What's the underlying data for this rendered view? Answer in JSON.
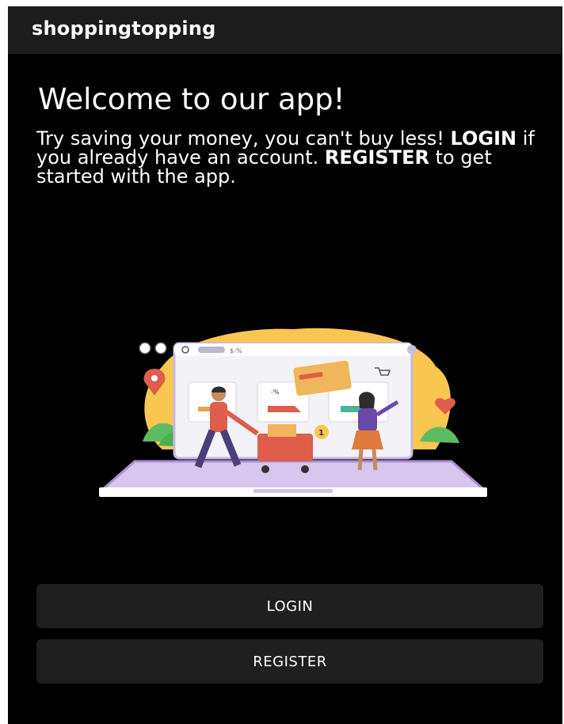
{
  "appbar": {
    "title": "shoppingtopping"
  },
  "main": {
    "welcome_title": "Welcome to our app!",
    "intro": {
      "part1": " Try saving your money, you can't buy less! ",
      "login_word": "LOGIN",
      "part2": " if you already have an account. ",
      "register_word": "REGISTER",
      "part3": " to get started with the app."
    },
    "illustration": {
      "search_text": "$-%",
      "price_badge": "1",
      "price_symbol": "$",
      "discount_text": "-%"
    }
  },
  "buttons": {
    "login_label": "LOGIN",
    "register_label": "REGISTER"
  },
  "colors": {
    "background": "#000000",
    "appbar": "#1c1c1c",
    "button": "#1f1f1f",
    "text": "#ffffff"
  }
}
